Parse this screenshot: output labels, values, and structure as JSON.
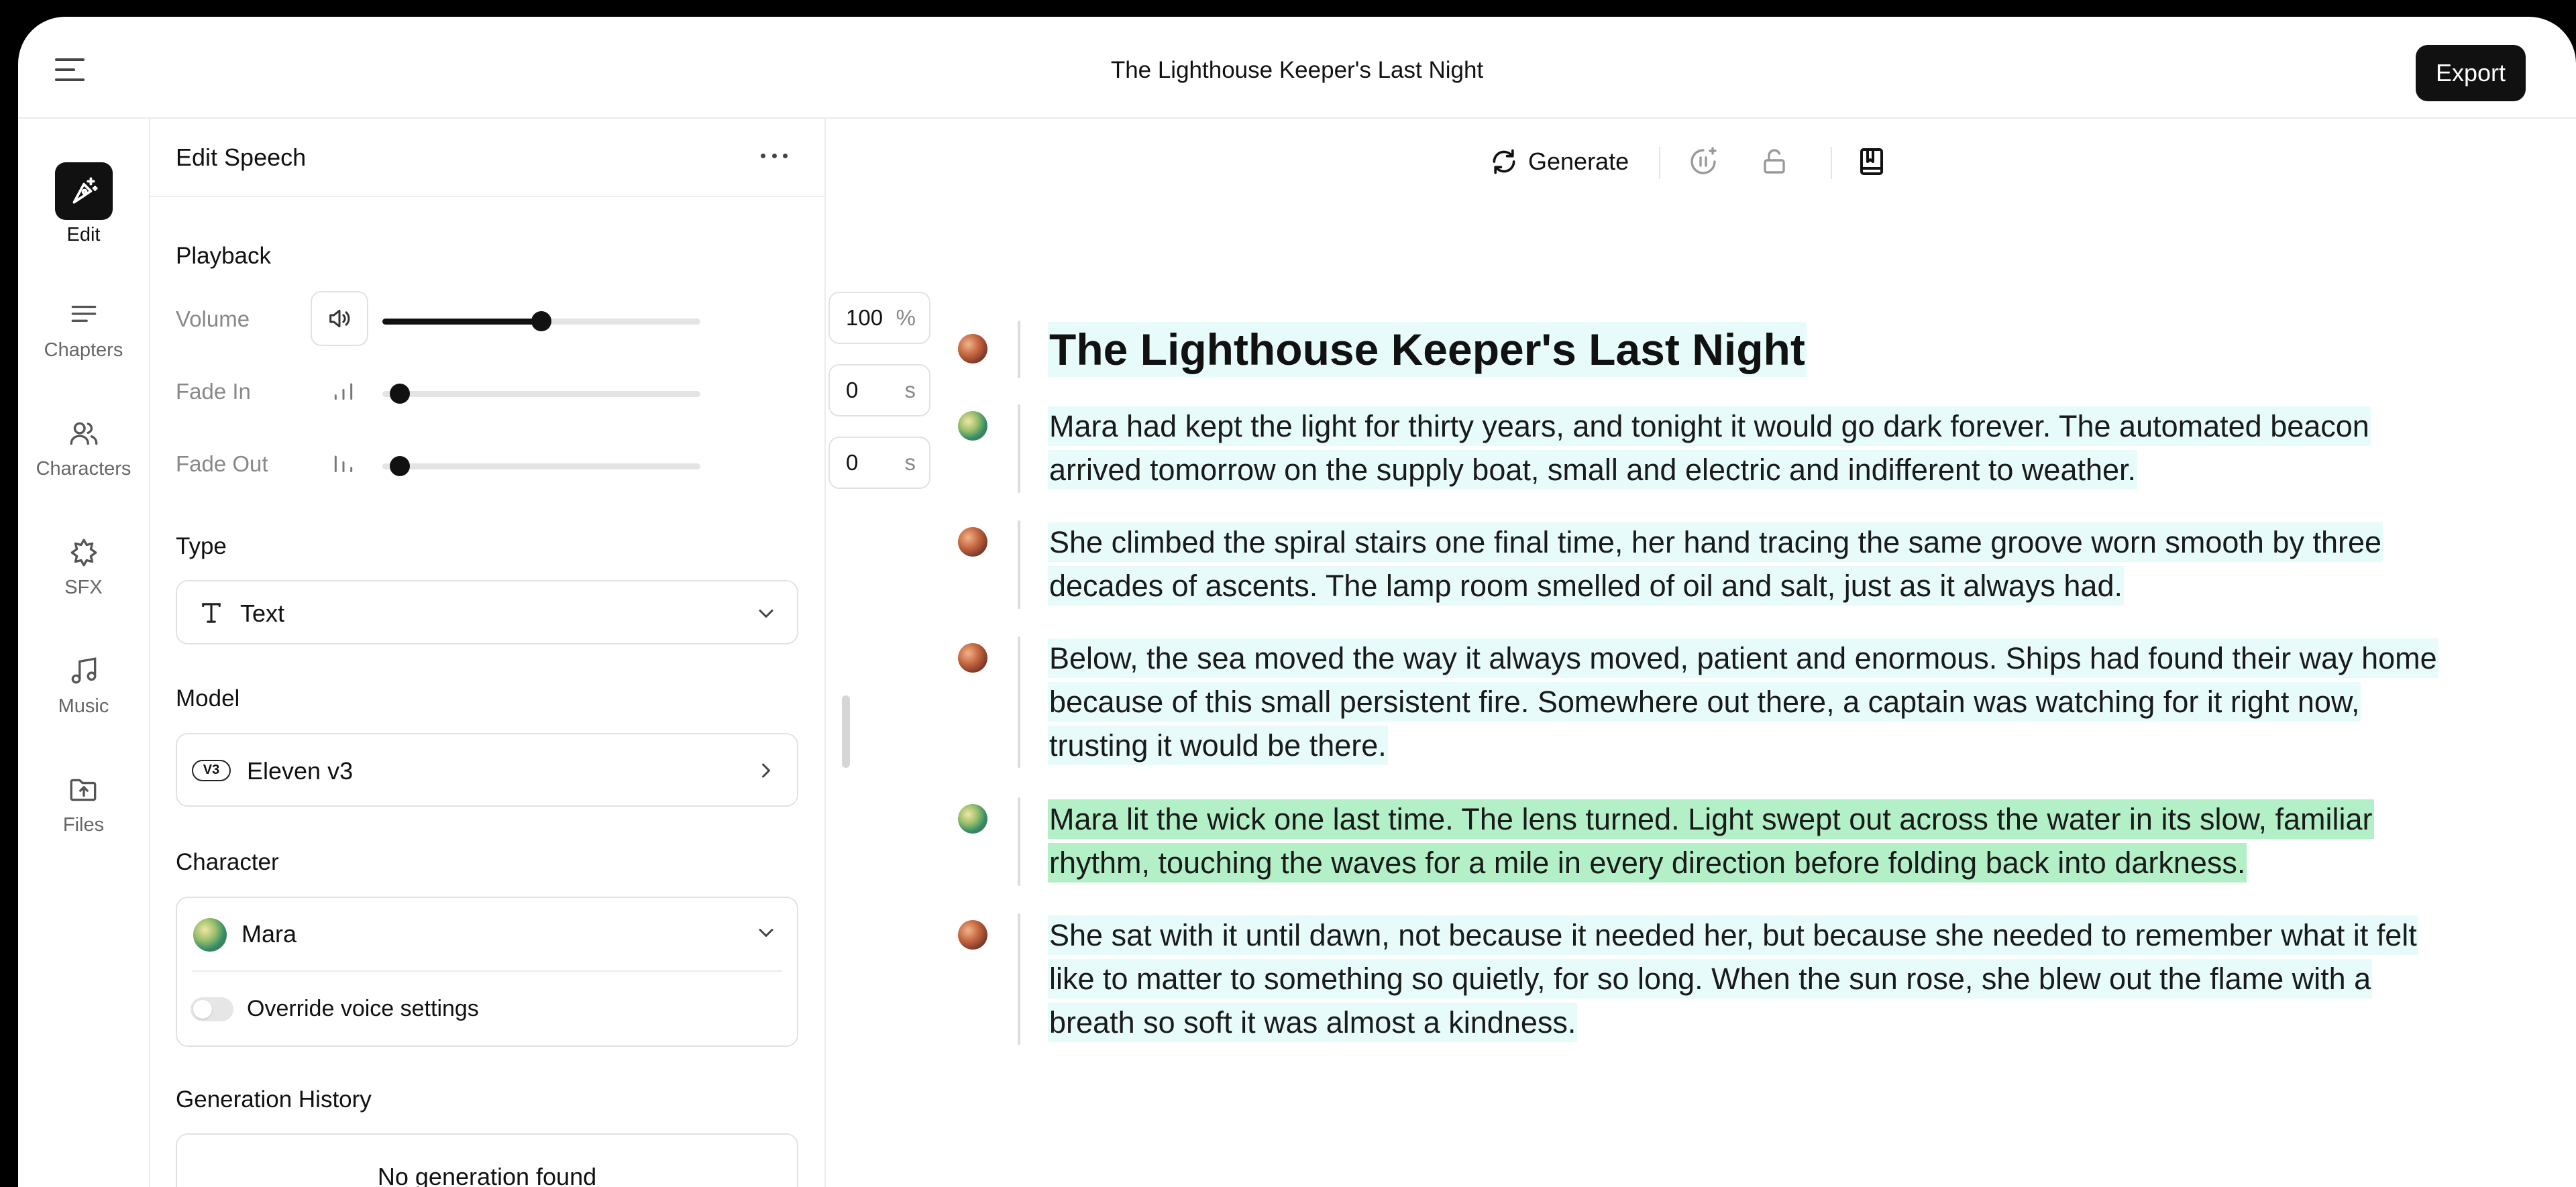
{
  "header": {
    "title": "The Lighthouse Keeper's Last Night",
    "export_label": "Export"
  },
  "rail": {
    "items": [
      {
        "label": "Edit",
        "icon": "edit-sparkle-icon",
        "active": true
      },
      {
        "label": "Chapters",
        "icon": "chapters-icon"
      },
      {
        "label": "Characters",
        "icon": "characters-icon"
      },
      {
        "label": "SFX",
        "icon": "sfx-icon"
      },
      {
        "label": "Music",
        "icon": "music-icon"
      },
      {
        "label": "Files",
        "icon": "files-icon"
      }
    ]
  },
  "panel": {
    "title": "Edit Speech",
    "playback": {
      "label": "Playback",
      "volume": {
        "label": "Volume",
        "value": "100",
        "unit": "%",
        "level": 0.5
      },
      "fade_in": {
        "label": "Fade In",
        "value": "0",
        "unit": "s",
        "level": 0
      },
      "fade_out": {
        "label": "Fade Out",
        "value": "0",
        "unit": "s",
        "level": 0
      }
    },
    "type": {
      "label": "Type",
      "value": "Text"
    },
    "model": {
      "label": "Model",
      "badge": "V3",
      "value": "Eleven v3"
    },
    "character": {
      "label": "Character",
      "value": "Mara",
      "override_label": "Override voice settings",
      "override_on": false
    },
    "history": {
      "label": "Generation History",
      "empty": "No generation found"
    }
  },
  "toolbar": {
    "generate_label": "Generate"
  },
  "document": {
    "blocks": [
      {
        "speaker": "narrator",
        "kind": "heading",
        "text": "The Lighthouse Keeper's Last Night"
      },
      {
        "speaker": "mara",
        "kind": "para",
        "text": "Mara had kept the light for thirty years, and tonight it would go dark forever. The automated beacon arrived tomorrow on the supply boat, small and electric and indifferent to weather."
      },
      {
        "speaker": "narrator",
        "kind": "para",
        "text": "She climbed the spiral stairs one final time, her hand tracing the same groove worn smooth by three decades of ascents. The lamp room smelled of oil and salt, just as it always had."
      },
      {
        "speaker": "narrator",
        "kind": "para",
        "text": "Below, the sea moved the way it always moved, patient and enormous. Ships had found their way home because of this small persistent fire. Somewhere out there, a captain was watching for it right now, trusting it would be there."
      },
      {
        "speaker": "mara",
        "kind": "para",
        "selected": true,
        "text": "Mara lit the wick one last time. The lens turned. Light swept out across the water in its slow, familiar rhythm, touching the waves for a mile in every direction before folding back into darkness."
      },
      {
        "speaker": "narrator",
        "kind": "para",
        "text": "She sat with it until dawn, not because it needed her, but because she needed to remember what it felt like to matter to something so quietly, for so long. When the sun rose, she blew out the flame with a breath so soft it was almost a kindness."
      }
    ]
  },
  "colors": {
    "text_highlight": "#e7fbfb",
    "selected_highlight": "#b3f0c8",
    "accent_dark": "#111111"
  }
}
